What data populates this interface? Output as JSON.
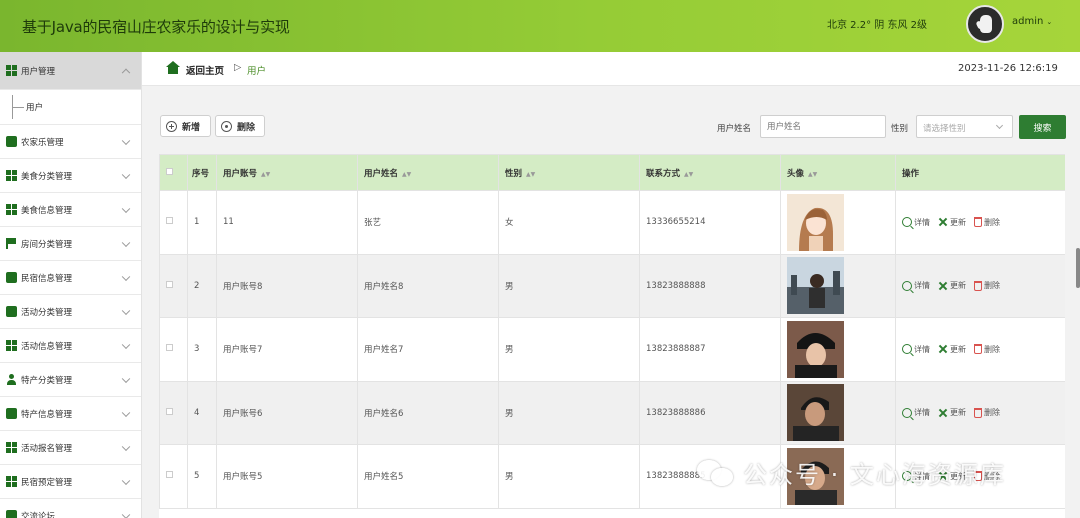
{
  "header": {
    "title": "基于Java的民宿山庄农家乐的设计与实现",
    "weather": "北京  2.2°  阴  东风  2级",
    "username": "admin"
  },
  "sidebar": {
    "items": [
      {
        "label": "用户管理",
        "icon": "grid-icon",
        "active": true
      },
      {
        "label": "农家乐管理",
        "icon": "square-icon"
      },
      {
        "label": "美食分类管理",
        "icon": "grid-icon"
      },
      {
        "label": "美食信息管理",
        "icon": "grid-icon"
      },
      {
        "label": "房间分类管理",
        "icon": "flag-icon"
      },
      {
        "label": "民宿信息管理",
        "icon": "square-icon"
      },
      {
        "label": "活动分类管理",
        "icon": "square-icon"
      },
      {
        "label": "活动信息管理",
        "icon": "grid-icon"
      },
      {
        "label": "特产分类管理",
        "icon": "person-icon"
      },
      {
        "label": "特产信息管理",
        "icon": "square-icon"
      },
      {
        "label": "活动报名管理",
        "icon": "grid-icon"
      },
      {
        "label": "民宿预定管理",
        "icon": "grid-icon"
      },
      {
        "label": "交流论坛",
        "icon": "square-icon"
      }
    ],
    "sub_item": "用户"
  },
  "breadcrumb": {
    "home": "返回主页",
    "separator": "▷",
    "current": "用户"
  },
  "clock": "2023-11-26 12:6:19",
  "toolbar": {
    "add_label": "新增",
    "delete_label": "删除",
    "name_label": "用户姓名",
    "name_placeholder": "用户姓名",
    "sex_label": "性别",
    "sex_placeholder": "请选择性别",
    "search_label": "搜索"
  },
  "table": {
    "columns": [
      "序号",
      "用户账号",
      "用户姓名",
      "性别",
      "联系方式",
      "头像",
      "操作"
    ],
    "actions": {
      "detail": "详情",
      "update": "更新",
      "delete": "删除"
    },
    "rows": [
      {
        "no": "1",
        "account": "11",
        "name": "张艺",
        "sex": "女",
        "phone": "13336655214"
      },
      {
        "no": "2",
        "account": "用户账号8",
        "name": "用户姓名8",
        "sex": "男",
        "phone": "13823888888"
      },
      {
        "no": "3",
        "account": "用户账号7",
        "name": "用户姓名7",
        "sex": "男",
        "phone": "13823888887"
      },
      {
        "no": "4",
        "account": "用户账号6",
        "name": "用户姓名6",
        "sex": "男",
        "phone": "13823888886"
      },
      {
        "no": "5",
        "account": "用户账号5",
        "name": "用户姓名5",
        "sex": "男",
        "phone": "13823888885"
      }
    ]
  },
  "watermark": "公众号 · 文心海资源库",
  "colors": {
    "header_green": "#95cc36",
    "accent_green": "#2e7d32",
    "table_header_bg": "#d4ecc5"
  }
}
